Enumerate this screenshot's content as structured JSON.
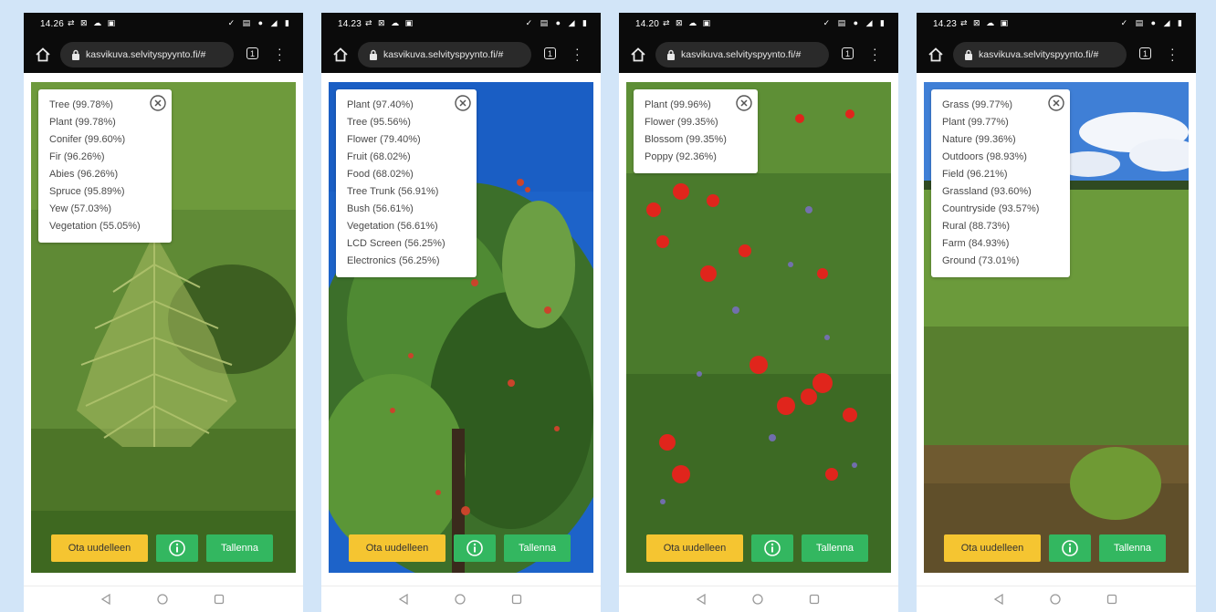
{
  "phones": [
    {
      "status_time": "14.26",
      "url": "kasvikuva.selvityspyynto.fi/#",
      "labels": [
        "Tree (99.78%)",
        "Plant (99.78%)",
        "Conifer (99.60%)",
        "Fir (96.26%)",
        "Abies (96.26%)",
        "Spruce (95.89%)",
        "Yew (57.03%)",
        "Vegetation (55.05%)"
      ],
      "retake_label": "Ota uudelleen",
      "save_label": "Tallenna"
    },
    {
      "status_time": "14.23",
      "url": "kasvikuva.selvityspyynto.fi/#",
      "labels": [
        "Plant (97.40%)",
        "Tree (95.56%)",
        "Flower (79.40%)",
        "Fruit (68.02%)",
        "Food (68.02%)",
        "Tree Trunk (56.91%)",
        "Bush (56.61%)",
        "Vegetation (56.61%)",
        "LCD Screen (56.25%)",
        "Electronics (56.25%)"
      ],
      "retake_label": "Ota uudelleen",
      "save_label": "Tallenna"
    },
    {
      "status_time": "14.20",
      "url": "kasvikuva.selvityspyynto.fi/#",
      "labels": [
        "Plant (99.96%)",
        "Flower (99.35%)",
        "Blossom (99.35%)",
        "Poppy (92.36%)"
      ],
      "retake_label": "Ota uudelleen",
      "save_label": "Tallenna"
    },
    {
      "status_time": "14.23",
      "url": "kasvikuva.selvityspyynto.fi/#",
      "labels": [
        "Grass (99.77%)",
        "Plant (99.77%)",
        "Nature (99.36%)",
        "Outdoors (98.93%)",
        "Field (96.21%)",
        "Grassland (93.60%)",
        "Countryside (93.57%)",
        "Rural (88.73%)",
        "Farm (84.93%)",
        "Ground (73.01%)"
      ],
      "retake_label": "Ota uudelleen",
      "save_label": "Tallenna"
    }
  ],
  "icons": {
    "home": "home-icon",
    "lock": "lock-icon",
    "tabs": "tab-switcher-icon",
    "menu": "overflow-menu-icon",
    "close": "close-icon",
    "info": "info-icon",
    "back": "nav-back-icon",
    "home_nav": "nav-home-icon",
    "recents": "nav-recents-icon"
  },
  "colors": {
    "retake_button": "#f5c531",
    "action_button": "#33b760",
    "status_bar": "#0b0b0b"
  }
}
